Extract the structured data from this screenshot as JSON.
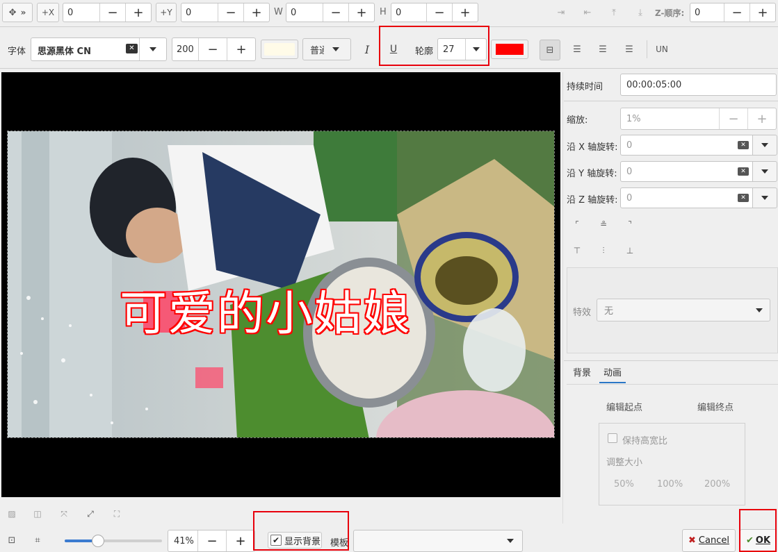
{
  "toolbar1": {
    "move_icon": "move-icon",
    "more": "»",
    "plus_x": "+X",
    "x_value": "0",
    "plus_y": "+Y",
    "y_value": "0",
    "w_label": "W",
    "w_value": "0",
    "h_label": "H",
    "h_value": "0",
    "minus": "−",
    "plus": "+",
    "zorder_label": "Z-顺序:",
    "zorder_value": "0"
  },
  "toolbar2": {
    "font_label": "字体",
    "font_value": "思源黑体 CN",
    "size_value": "200",
    "weight_value": "普通",
    "italic": "I",
    "underline": "U",
    "outline_label": "轮廓",
    "outline_value": "27",
    "outline_color": "#ff0000",
    "text_color": "#fffbe8",
    "un_label": "UN"
  },
  "canvas": {
    "title_text": "可爱的小姑娘",
    "title_color": "#ffffff",
    "outline_color": "#ff0000"
  },
  "right_panel": {
    "duration_label": "持续时间",
    "duration_value": "00:00:05:00",
    "scale_label": "缩放:",
    "scale_value": "1%",
    "rot_x_label": "沿 X 轴旋转:",
    "rot_x_value": "0",
    "rot_y_label": "沿 Y 轴旋转:",
    "rot_y_value": "0",
    "rot_z_label": "沿 Z 轴旋转:",
    "rot_z_value": "0",
    "effect_label": "特效",
    "effect_value": "无",
    "tabs": [
      {
        "label": "背景"
      },
      {
        "label": "动画"
      }
    ],
    "edit_start": "编辑起点",
    "edit_end": "编辑终点",
    "keep_ratio": "保持高宽比",
    "resize_label": "调整大小",
    "sizes": [
      "50%",
      "100%",
      "200%"
    ]
  },
  "bottom": {
    "zoom_value": "41%",
    "show_bg_label": "显示背景",
    "show_bg_checked": true,
    "template_label": "模板",
    "template_value": "",
    "cancel_label": "Cancel",
    "ok_label": "OK"
  }
}
